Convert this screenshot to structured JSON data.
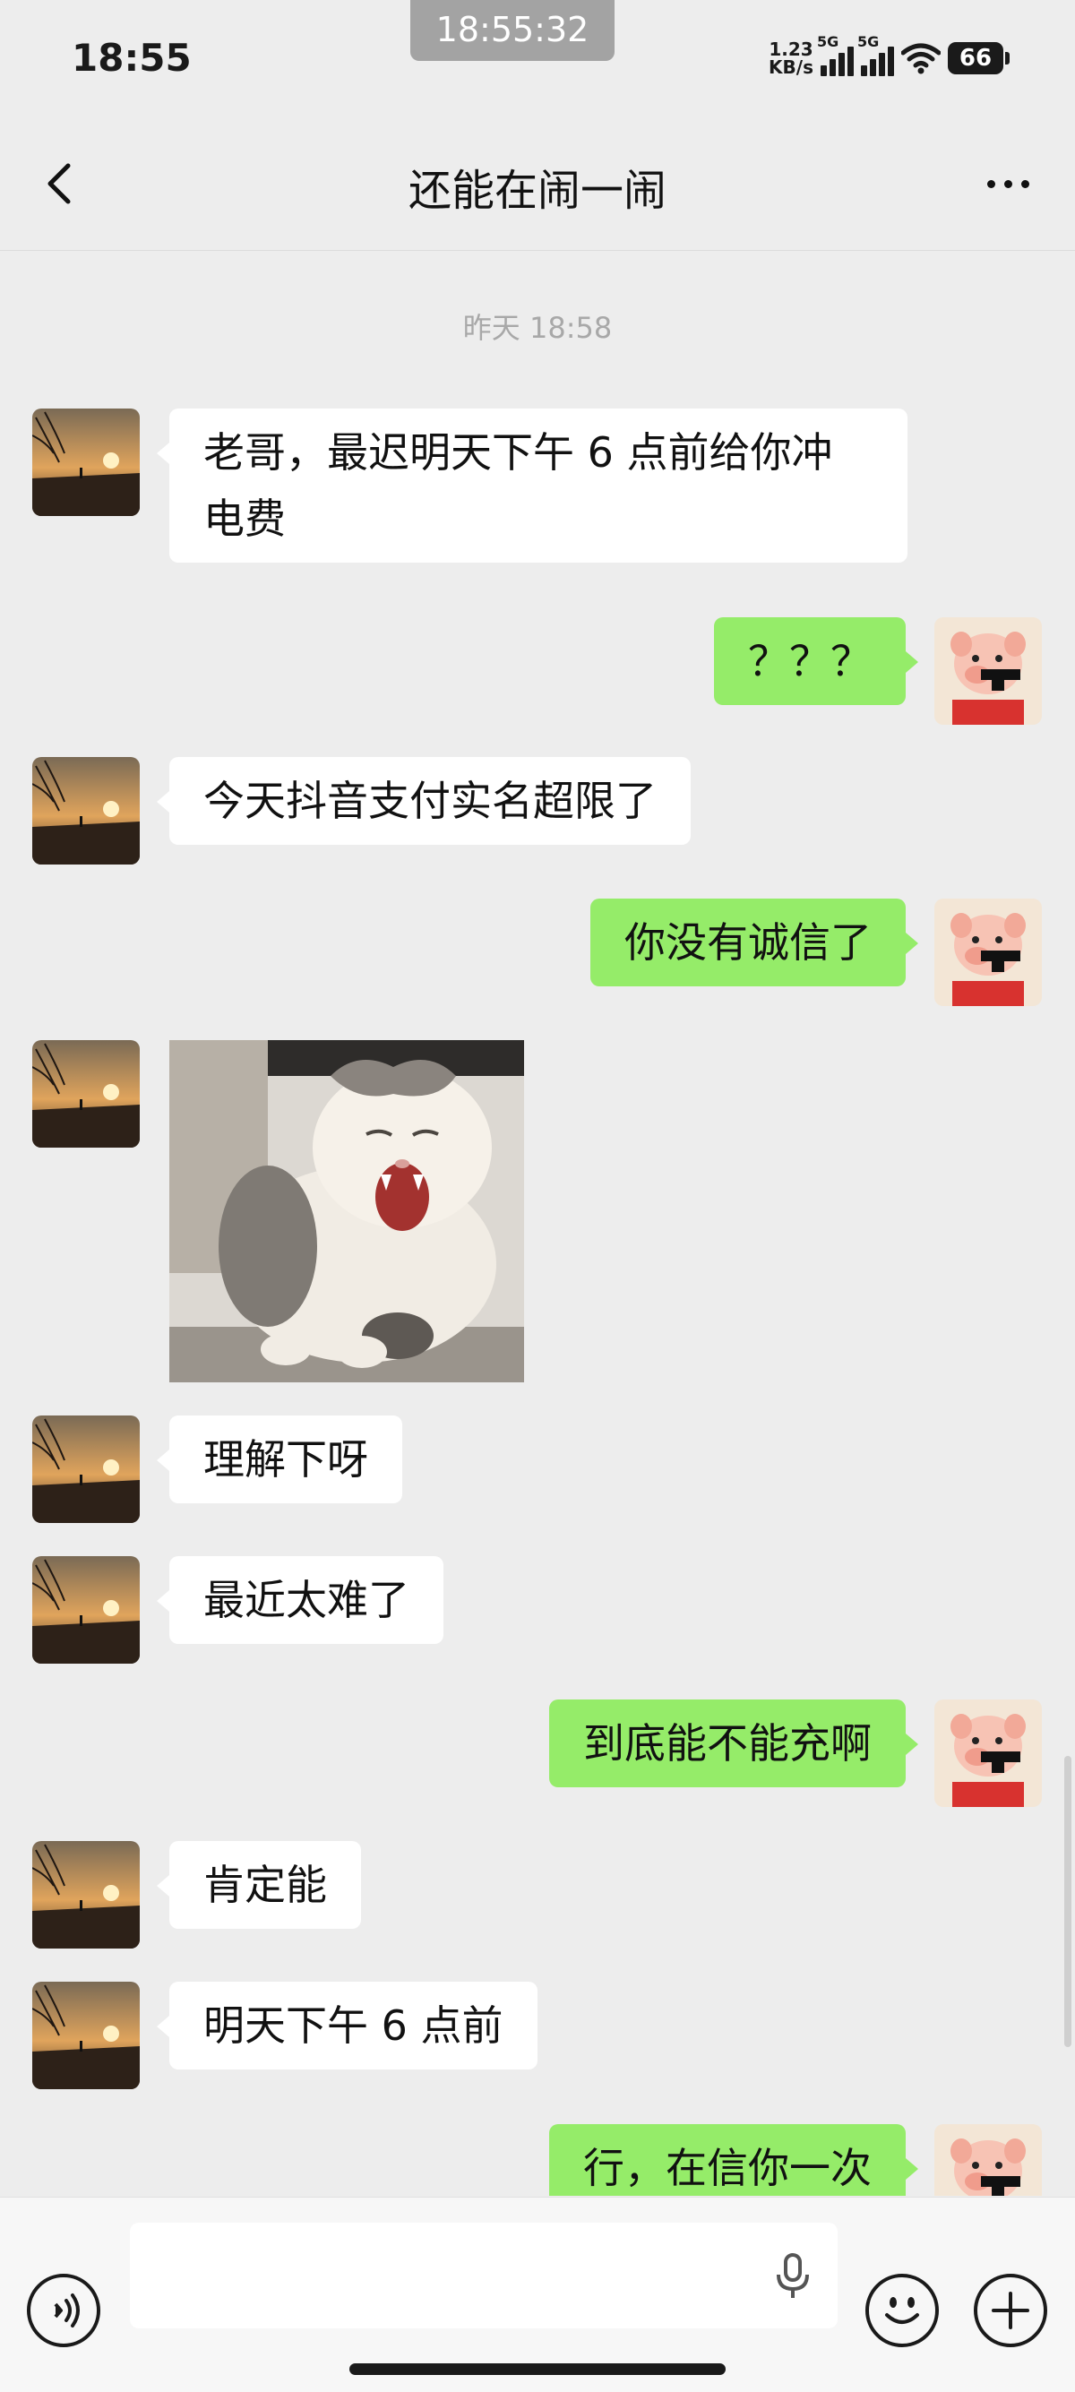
{
  "status_bar": {
    "time": "18:55",
    "screenshot_time": "18:55:32",
    "net_speed_value": "1.23",
    "net_speed_unit": "KB/s",
    "signal1_label": "5G",
    "signal2_label": "5G",
    "battery": "66"
  },
  "header": {
    "title": "还能在闹一闹"
  },
  "chat": {
    "timestamp": "昨天 18:58",
    "messages": [
      {
        "side": "left",
        "type": "text",
        "text": "老哥，最迟明天下午 6 点前给你冲电费"
      },
      {
        "side": "right",
        "type": "text",
        "text": "？？？"
      },
      {
        "side": "left",
        "type": "text",
        "text": "今天抖音支付实名超限了"
      },
      {
        "side": "right",
        "type": "text",
        "text": "你没有诚信了"
      },
      {
        "side": "left",
        "type": "sticker",
        "sticker": "laughing-cat"
      },
      {
        "side": "left",
        "type": "text",
        "text": "理解下呀"
      },
      {
        "side": "left",
        "type": "text",
        "text": "最近太难了"
      },
      {
        "side": "right",
        "type": "text",
        "text": "到底能不能充啊"
      },
      {
        "side": "left",
        "type": "text",
        "text": "肯定能"
      },
      {
        "side": "left",
        "type": "text",
        "text": "明天下午 6 点前"
      },
      {
        "side": "right",
        "type": "text",
        "text": "行，在信你一次"
      }
    ]
  },
  "colors": {
    "background": "#ededed",
    "bubble_self": "#95ec69",
    "bubble_other": "#ffffff"
  },
  "icons": {
    "back": "chevron-left-icon",
    "more": "more-dots-icon",
    "voice": "voice-icon",
    "mic": "mic-icon",
    "emoji": "emoji-icon",
    "plus": "plus-icon"
  }
}
